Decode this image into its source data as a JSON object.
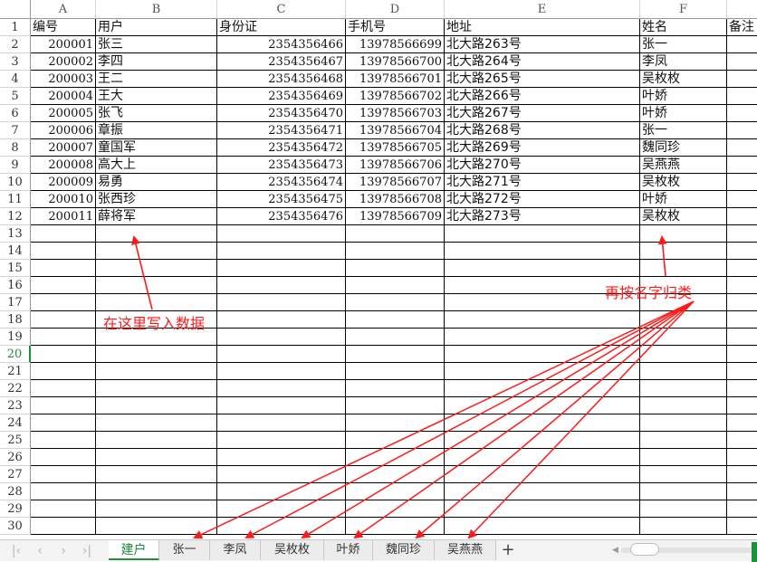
{
  "columns": [
    "A",
    "B",
    "C",
    "D",
    "E",
    "F",
    ""
  ],
  "row_numbers": [
    "1",
    "2",
    "3",
    "4",
    "5",
    "6",
    "7",
    "8",
    "9",
    "10",
    "11",
    "12",
    "13",
    "14",
    "15",
    "16",
    "17",
    "18",
    "19",
    "20",
    "21",
    "22",
    "23",
    "24",
    "25",
    "26",
    "27",
    "28",
    "29",
    "30"
  ],
  "selected_row": "20",
  "rows": [
    [
      "编号",
      "用户",
      "身份证",
      "手机号",
      "地址",
      "姓名",
      "备注"
    ],
    [
      "200001",
      "张三",
      "2354356466",
      "13978566699",
      "北大路263号",
      "张一",
      ""
    ],
    [
      "200002",
      "李四",
      "2354356467",
      "13978566700",
      "北大路264号",
      "李凤",
      ""
    ],
    [
      "200003",
      "王二",
      "2354356468",
      "13978566701",
      "北大路265号",
      "吴枚枚",
      ""
    ],
    [
      "200004",
      "王大",
      "2354356469",
      "13978566702",
      "北大路266号",
      "叶娇",
      ""
    ],
    [
      "200005",
      "张飞",
      "2354356470",
      "13978566703",
      "北大路267号",
      "叶娇",
      ""
    ],
    [
      "200006",
      "章振",
      "2354356471",
      "13978566704",
      "北大路268号",
      "张一",
      ""
    ],
    [
      "200007",
      "童国军",
      "2354356472",
      "13978566705",
      "北大路269号",
      "魏同珍",
      ""
    ],
    [
      "200008",
      "高大上",
      "2354356473",
      "13978566706",
      "北大路270号",
      "吴燕燕",
      ""
    ],
    [
      "200009",
      "易勇",
      "2354356474",
      "13978566707",
      "北大路271号",
      "吴枚枚",
      ""
    ],
    [
      "200010",
      "张西珍",
      "2354356475",
      "13978566708",
      "北大路272号",
      "叶娇",
      ""
    ],
    [
      "200011",
      "薛将军",
      "2354356476",
      "13978566709",
      "北大路273号",
      "吴枚枚",
      ""
    ]
  ],
  "annotations": {
    "write_here": "在这里写入数据",
    "group_by_name": "再按名字归类"
  },
  "sheet_tabs": [
    "建户",
    "张一",
    "李凤",
    "吴枚枚",
    "叶娇",
    "魏同珍",
    "吴燕燕"
  ],
  "active_tab": "建户",
  "add_tab_label": "+",
  "colors": {
    "accent": "#1f8f3a",
    "annotation": "#ff1a1a"
  }
}
